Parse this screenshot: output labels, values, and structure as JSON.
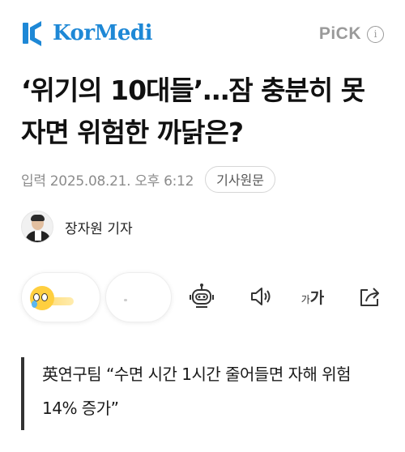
{
  "header": {
    "logo_text": "KorMedi",
    "pick_label": "PiCK",
    "info_glyph": "i",
    "brand_color": "#1e88d6"
  },
  "article": {
    "title": "‘위기의 10대들’…잠 충분히 못 자면 위험한 까닭은?",
    "date": "입력 2025.08.21. 오후 6:12",
    "source_button": "기사원문",
    "author_name": "장자원 기자",
    "subheading": "英연구팀 “수면 시간 1시간 줄어들면 자해 위험 14% 증가”"
  },
  "toolbar": {
    "font_small": "가",
    "font_large": "가",
    "icons": [
      "reaction-icon",
      "robot-icon",
      "speaker-icon",
      "font-size-icon",
      "share-icon"
    ]
  }
}
